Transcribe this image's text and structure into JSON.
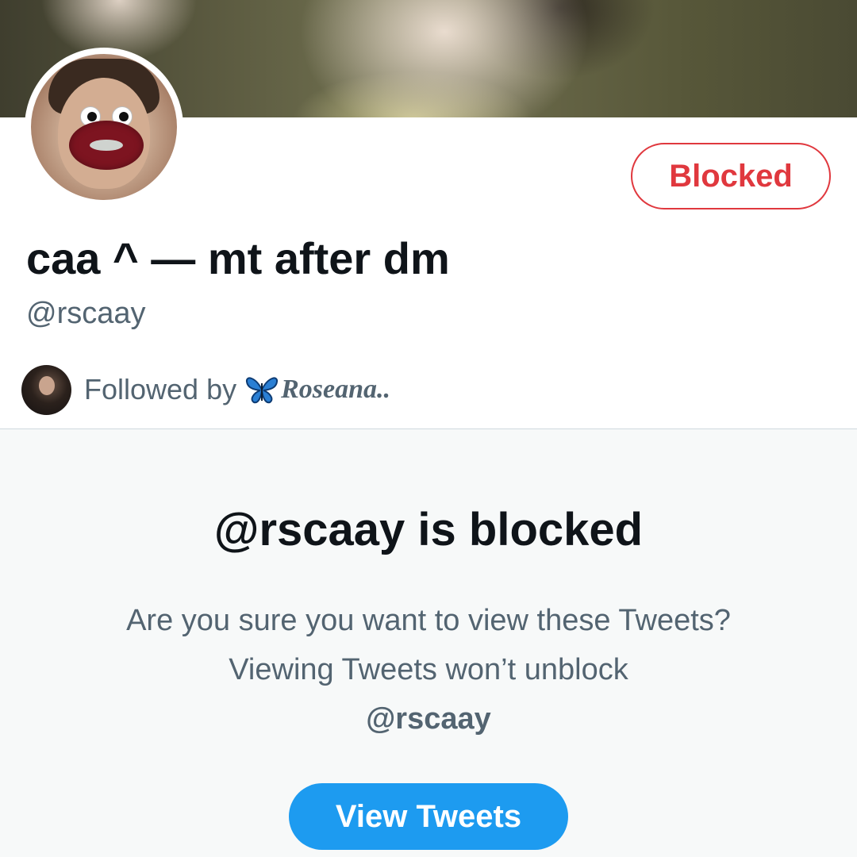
{
  "profile": {
    "display_name": "caa ^ — mt after dm",
    "handle": "@rscaay",
    "block_button_label": "Blocked",
    "followed_by_label": "Followed by",
    "followed_by_name": "Roseana..",
    "followed_by_emoji_icon": "butterfly-icon"
  },
  "notice": {
    "title": "@rscaay is blocked",
    "body": "Are you sure you want to view these Tweets? Viewing Tweets won’t unblock",
    "body_handle": "@rscaay",
    "button_label": "View Tweets"
  },
  "colors": {
    "blocked_red": "#e0383e",
    "twitter_blue": "#1d9bf0",
    "secondary_text": "#536471",
    "primary_text": "#0f1419"
  }
}
